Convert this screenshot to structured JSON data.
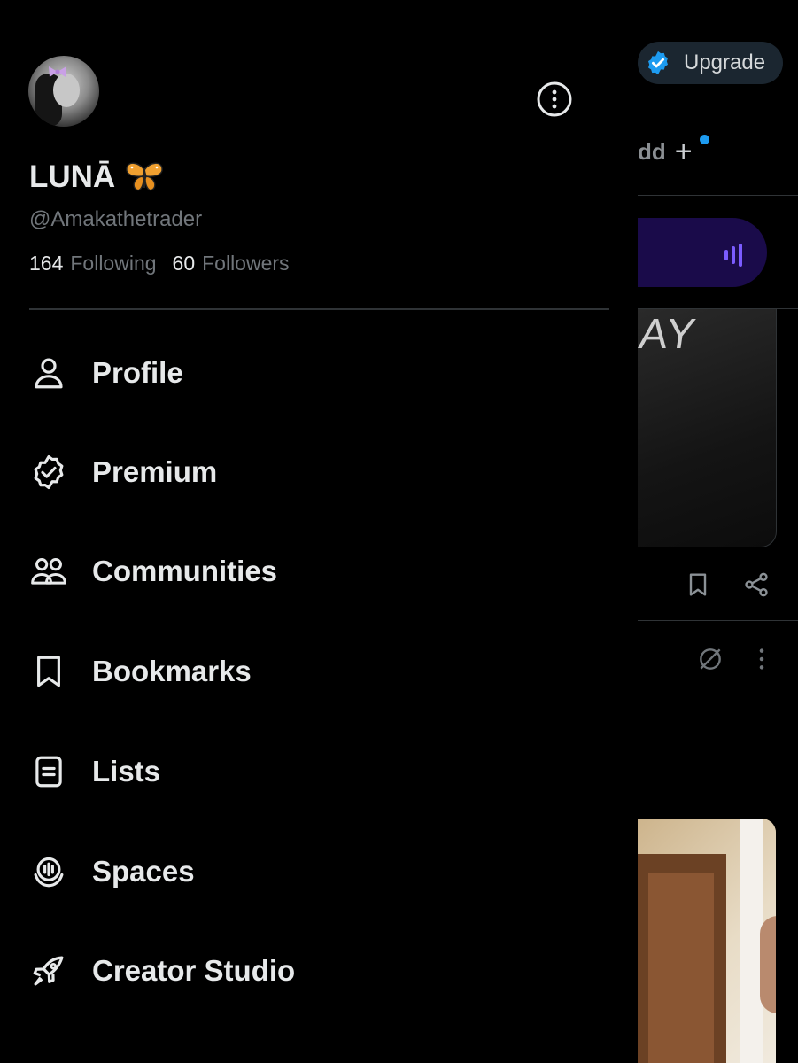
{
  "header": {
    "display_name": "LUNĀ",
    "handle": "@Amakathetrader",
    "following_count": "164",
    "following_label": "Following",
    "followers_count": "60",
    "followers_label": "Followers",
    "more_icon": "more-vertical-icon",
    "avatar_icon": "profile-avatar"
  },
  "menu": {
    "items": [
      {
        "label": "Profile",
        "icon": "person-icon"
      },
      {
        "label": "Premium",
        "icon": "verified-badge-icon"
      },
      {
        "label": "Communities",
        "icon": "people-icon"
      },
      {
        "label": "Bookmarks",
        "icon": "bookmark-icon"
      },
      {
        "label": "Lists",
        "icon": "list-icon"
      },
      {
        "label": "Spaces",
        "icon": "spaces-icon"
      },
      {
        "label": "Creator Studio",
        "icon": "rocket-icon"
      }
    ]
  },
  "background_feed": {
    "upgrade_label": "Upgrade",
    "tab_partial_label": "dd",
    "media_partial_text": "AY"
  },
  "colors": {
    "background": "#000000",
    "text_primary": "#e7e9ea",
    "text_secondary": "#71767b",
    "accent_blue": "#1d9bf0",
    "divider": "#2f3336",
    "spaces_purple": "#7b5cff"
  }
}
